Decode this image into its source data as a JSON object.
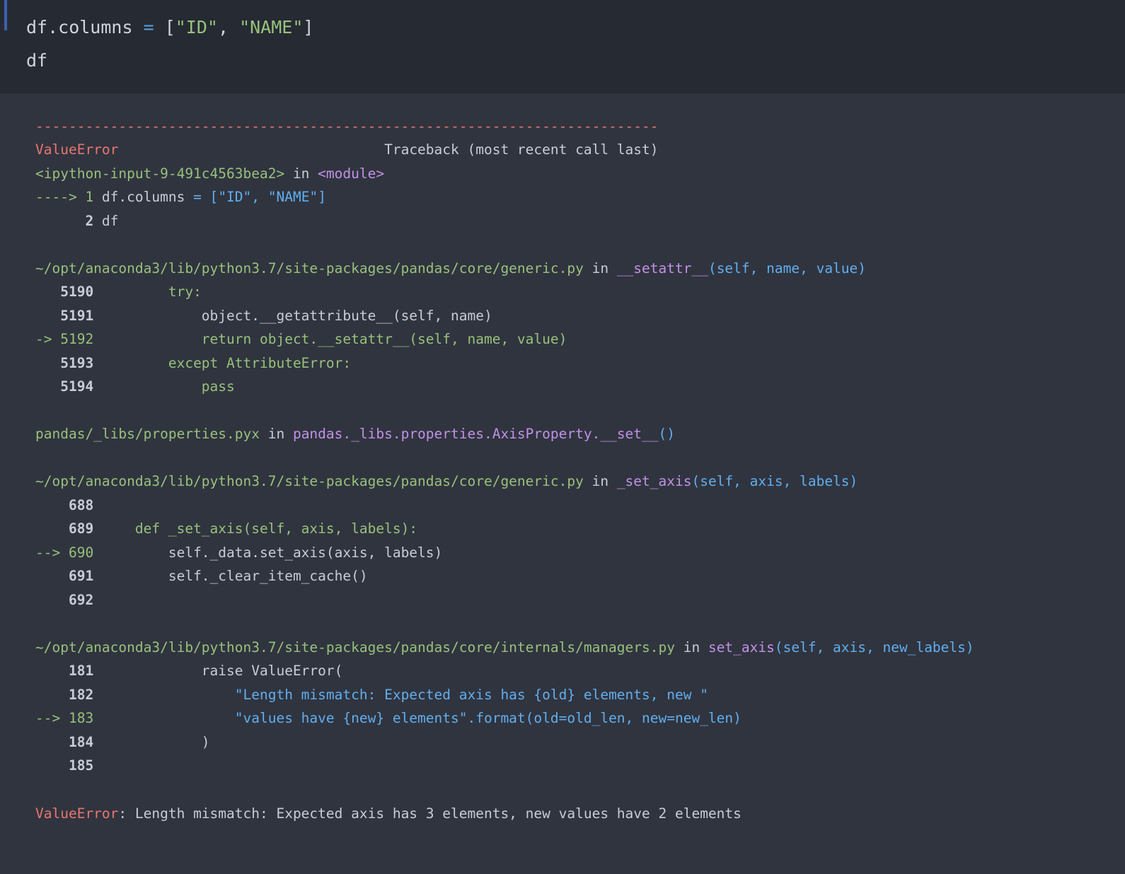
{
  "input_cell": {
    "line1_prefix": "df.columns ",
    "line1_op": "=",
    "line1_open": " [",
    "line1_str1": "\"ID\"",
    "line1_comma": ", ",
    "line1_str2": "\"NAME\"",
    "line1_close": "]",
    "line2": "df"
  },
  "traceback": {
    "separator": "---------------------------------------------------------------------------",
    "error_name": "ValueError",
    "header_spacer": "                                ",
    "header_text": "Traceback (most recent call last)",
    "frame1": {
      "file": "<ipython-input-9-491c4563bea2>",
      "in": " in ",
      "func": "<module>",
      "l1_arrow": "----> 1",
      "l1_code_a": " df.columns ",
      "l1_code_b": "= [",
      "l1_code_c": "\"ID\", \"NAME\"",
      "l1_code_d": "]",
      "l2_num": "      2",
      "l2_code": " df"
    },
    "frame2": {
      "file": "~/opt/anaconda3/lib/python3.7/site-packages/pandas/core/generic.py",
      "in": " in ",
      "func": "__setattr__",
      "args": "(self, name, value)",
      "lines": [
        {
          "num": "   5190",
          "code": "         try:"
        },
        {
          "num": "   5191",
          "code": "             object.__getattribute__(self, name)"
        },
        {
          "num": "-> 5192",
          "code": "             return object.__setattr__(self, name, value)"
        },
        {
          "num": "   5193",
          "code": "         except AttributeError:"
        },
        {
          "num": "   5194",
          "code": "             pass"
        }
      ]
    },
    "frame3": {
      "file": "pandas/_libs/properties.pyx",
      "in": " in ",
      "func": "pandas._libs.properties.AxisProperty.__set__",
      "args": "()"
    },
    "frame4": {
      "file": "~/opt/anaconda3/lib/python3.7/site-packages/pandas/core/generic.py",
      "in": " in ",
      "func": "_set_axis",
      "args": "(self, axis, labels)",
      "lines": [
        {
          "num": "    688",
          "code": ""
        },
        {
          "num": "    689",
          "code": "     def _set_axis(self, axis, labels):"
        },
        {
          "num": "--> 690",
          "code": "         self._data.set_axis(axis, labels)"
        },
        {
          "num": "    691",
          "code": "         self._clear_item_cache()"
        },
        {
          "num": "    692",
          "code": ""
        }
      ]
    },
    "frame5": {
      "file": "~/opt/anaconda3/lib/python3.7/site-packages/pandas/core/internals/managers.py",
      "in": " in ",
      "func": "set_axis",
      "args": "(self, axis, new_labels)",
      "lines": [
        {
          "num": "    181",
          "code": "             raise ValueError("
        },
        {
          "num": "    182",
          "code": "                 \"Length mismatch: Expected axis has {old} elements, new \""
        },
        {
          "num": "--> 183",
          "code": "                 \"values have {new} elements\".format(old=old_len, new=new_len)"
        },
        {
          "num": "    184",
          "code": "             )"
        },
        {
          "num": "    185",
          "code": ""
        }
      ]
    },
    "final_error_name": "ValueError",
    "final_message": ": Length mismatch: Expected axis has 3 elements, new values have 2 elements"
  }
}
